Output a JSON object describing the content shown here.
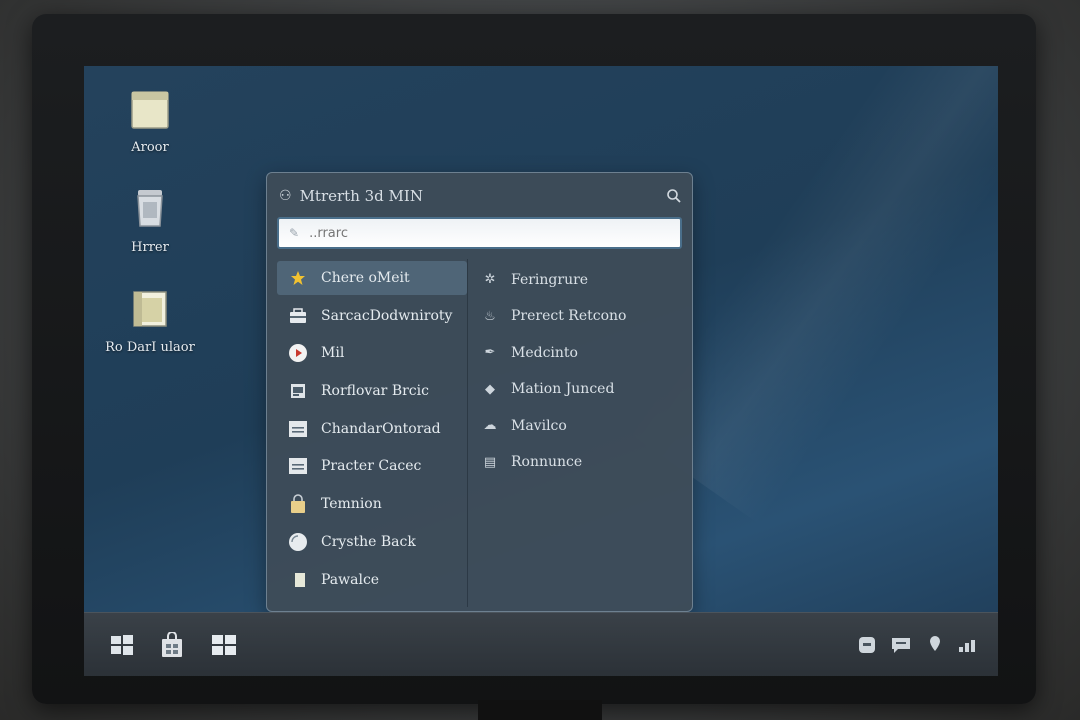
{
  "desktop": {
    "icons": [
      {
        "label": "Aroor",
        "icon": "folder-icon"
      },
      {
        "label": "Hrrer",
        "icon": "bin-icon"
      },
      {
        "label": "Ro DarI ulaor",
        "icon": "document-icon"
      }
    ]
  },
  "launcher": {
    "title": "Mtrerth 3d MIN",
    "search_placeholder": "..rrarc",
    "left_items": [
      {
        "label": "Chere oMeit",
        "icon": "star-icon",
        "selected": true
      },
      {
        "label": "SarcacDodwniroty",
        "icon": "toolbox-icon"
      },
      {
        "label": "Mil",
        "icon": "play-icon"
      },
      {
        "label": "Rorflovar Brcic",
        "icon": "window-icon"
      },
      {
        "label": "ChandarOntorad",
        "icon": "list-icon"
      },
      {
        "label": "Practer Cacec",
        "icon": "list-icon"
      },
      {
        "label": "Temnion",
        "icon": "lock-icon"
      },
      {
        "label": "Crysthe Back",
        "icon": "globe-icon"
      },
      {
        "label": "Pawalce",
        "icon": "book-icon"
      }
    ],
    "right_items": [
      {
        "label": "Feringrure",
        "icon": "gear-icon"
      },
      {
        "label": "Prerect Retcono",
        "icon": "flame-icon"
      },
      {
        "label": "Medcinto",
        "icon": "pen-icon"
      },
      {
        "label": "Mation Junced",
        "icon": "cube-icon"
      },
      {
        "label": "Mavilco",
        "icon": "cloud-icon"
      },
      {
        "label": "Ronnunce",
        "icon": "printer-icon"
      }
    ]
  },
  "taskbar": {
    "buttons": [
      "start-icon",
      "store-icon",
      "windows-icon"
    ],
    "tray": [
      "chat-icon",
      "message-icon",
      "location-icon",
      "network-icon"
    ]
  },
  "colors": {
    "desktop": "#1f3e58",
    "panel": "#3e4c58",
    "selected": "#4f6577",
    "star": "#f2c230",
    "play": "#c8382e"
  }
}
